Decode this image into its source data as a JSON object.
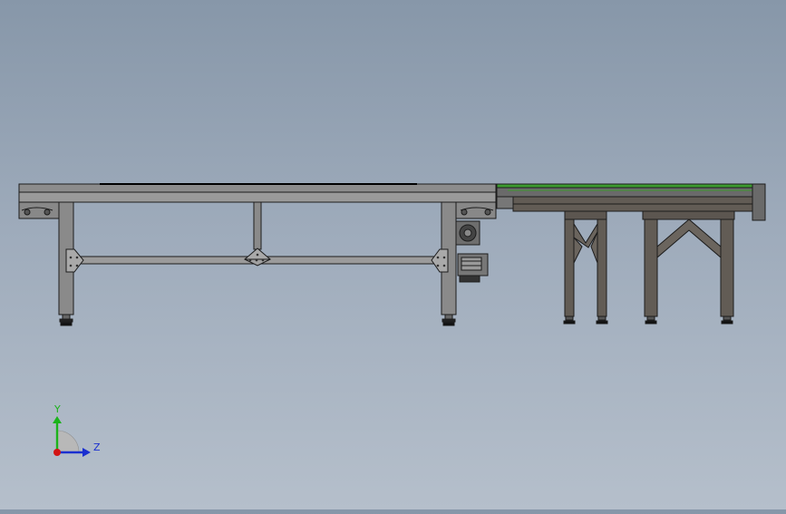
{
  "triad": {
    "y_label": "Y",
    "z_label": "Z",
    "colors": {
      "y": "#1bb31b",
      "z": "#1a2fd0",
      "x": "#d21414"
    }
  },
  "colors": {
    "frame_light": "#8f8f8f",
    "frame_mid": "#7a7a7a",
    "frame_dark": "#5f5a54",
    "outline": "#1c1c1c",
    "belt_green": "#3d9b2f",
    "plate": "#a8a8a8"
  },
  "icons": [
    "coordinate-triad-icon",
    "motor-icon",
    "gearbox-icon"
  ]
}
